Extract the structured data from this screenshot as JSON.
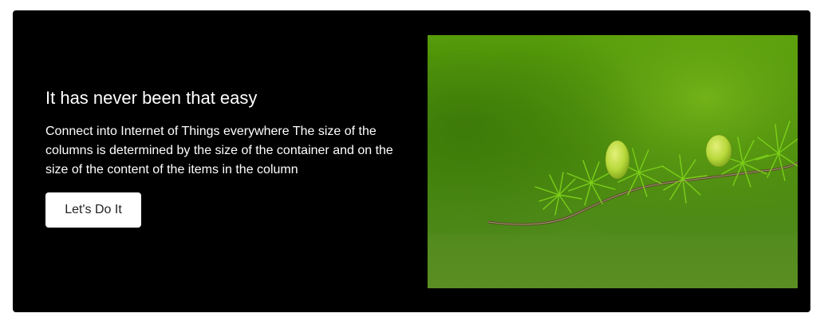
{
  "hero": {
    "title": "It has never been that easy",
    "description": "Connect into Internet of Things everywhere The size of the columns is determined by the size of the container and on the size of the content of the items in the column",
    "cta_label": "Let's Do It"
  },
  "image": {
    "subject": "larch-branch-photo"
  },
  "colors": {
    "card_background": "#000000",
    "text": "#ffffff",
    "button_background": "#ffffff",
    "photo_green": "#5a9e12"
  }
}
